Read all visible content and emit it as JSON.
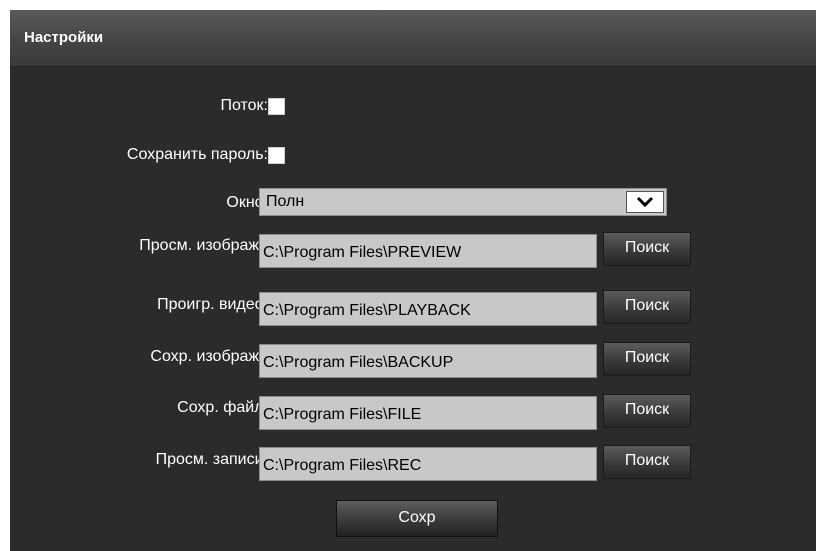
{
  "header": {
    "title": "Настройки"
  },
  "settings": {
    "stream": {
      "label": "Поток:",
      "checked": false
    },
    "save_password": {
      "label": "Сохранить пароль:",
      "checked": false
    },
    "window": {
      "label": "Окно:",
      "value": "Полн",
      "icon": "chevron-down-icon"
    }
  },
  "paths": [
    {
      "label": "Просм. изображ.:",
      "value": "C:\\Program Files\\PREVIEW",
      "button": "Поиск"
    },
    {
      "label": "Проигр. видео:",
      "value": "C:\\Program Files\\PLAYBACK",
      "button": "Поиск"
    },
    {
      "label": "Сохр. изображ.:",
      "value": "C:\\Program Files\\BACKUP",
      "button": "Поиск"
    },
    {
      "label": "Сохр. файл:",
      "value": "C:\\Program Files\\FILE",
      "button": "Поиск"
    },
    {
      "label": "Просм. записи:",
      "value": "C:\\Program Files\\REC",
      "button": "Поиск"
    }
  ],
  "footer": {
    "save_label": "Сохр"
  },
  "colors": {
    "panel_bg": "#2b2b2b",
    "field_bg": "#c8c8c8",
    "text": "#ffffff"
  }
}
